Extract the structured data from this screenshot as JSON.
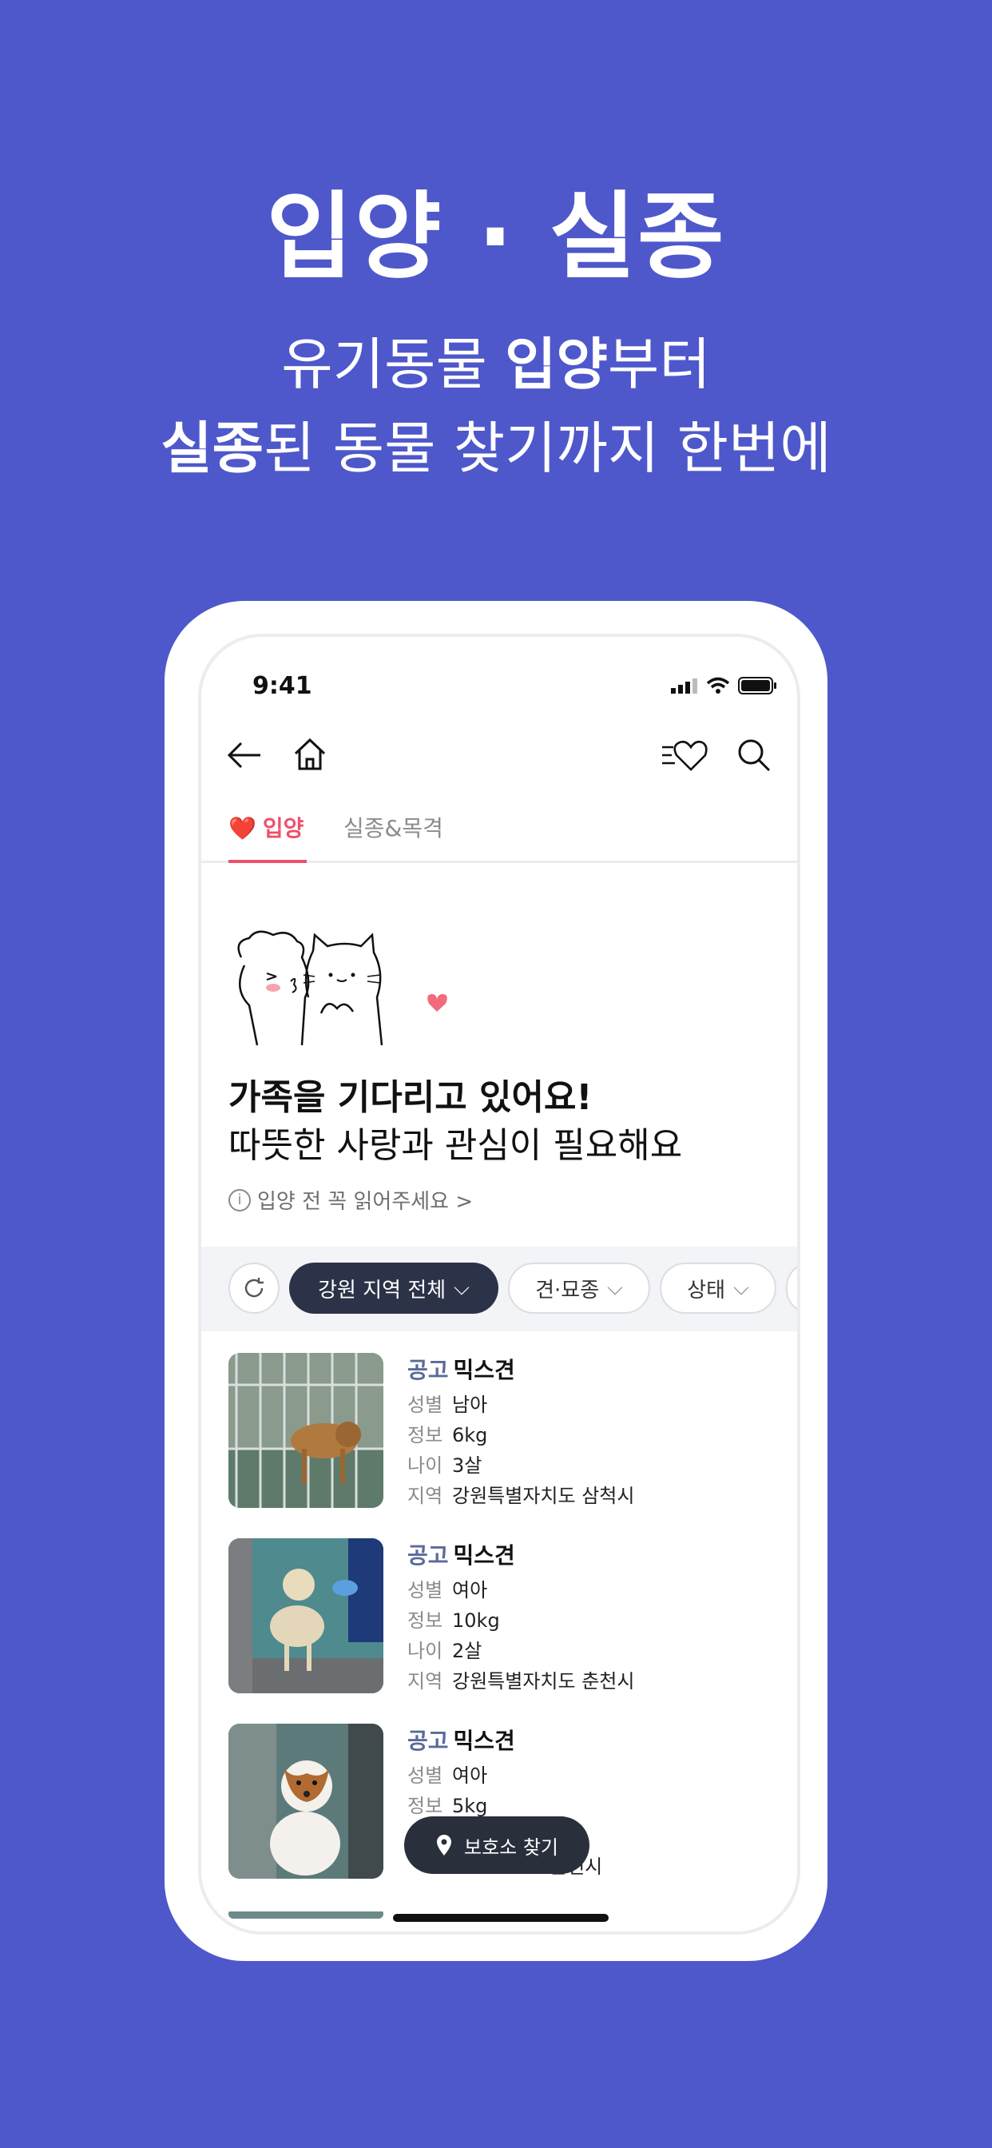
{
  "hero": {
    "headline": "입양 · 실종",
    "line1_pre": "유기동물 ",
    "line1_bold": "입양",
    "line1_post": "부터",
    "line2_bold": "실종",
    "line2_post": "된 동물 찾기까지 한번에"
  },
  "status": {
    "time": "9:41"
  },
  "nav": {
    "back_icon": "arrow-left-icon",
    "home_icon": "home-icon",
    "favorites_icon": "heart-list-icon",
    "search_icon": "search-icon"
  },
  "tabs": {
    "active": "입양",
    "inactive": "실종&목격"
  },
  "banner": {
    "title": "가족을 기다리고 있어요!",
    "subtitle": "따뜻한 사랑과 관심이 필요해요",
    "note": "입양 전 꼭 읽어주세요 >"
  },
  "filters": {
    "region": "강원 지역 전체",
    "species": "견·묘종",
    "status": "상태"
  },
  "labels": {
    "tag": "공고",
    "sex": "성별",
    "info": "정보",
    "age": "나이",
    "region": "지역"
  },
  "listings": [
    {
      "breed": "믹스견",
      "sex": "남아",
      "weight": "6kg",
      "age": "3살",
      "region": "강원특별자치도 삼척시"
    },
    {
      "breed": "믹스견",
      "sex": "여아",
      "weight": "10kg",
      "age": "2살",
      "region": "강원특별자치도 춘천시"
    },
    {
      "breed": "믹스견",
      "sex": "여아",
      "weight": "5kg",
      "age": "",
      "region": "춘천시"
    }
  ],
  "fab": {
    "label": "보호소 찾기"
  },
  "colors": {
    "background": "#4e58cb",
    "accent": "#ef4f6a",
    "chip_dark": "#2c3348"
  }
}
